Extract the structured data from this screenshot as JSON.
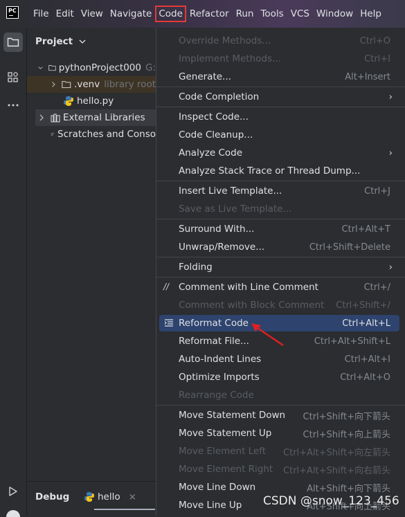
{
  "menubar": {
    "logo_text": "PC",
    "items": [
      {
        "label": "File"
      },
      {
        "label": "Edit"
      },
      {
        "label": "View"
      },
      {
        "label": "Navigate"
      },
      {
        "label": "Code"
      },
      {
        "label": "Refactor"
      },
      {
        "label": "Run"
      },
      {
        "label": "Tools"
      },
      {
        "label": "VCS"
      },
      {
        "label": "Window"
      },
      {
        "label": "Help"
      }
    ]
  },
  "project_panel": {
    "title": "Project",
    "tree": [
      {
        "label": "pythonProject000",
        "suffix": "G:"
      },
      {
        "label": ".venv",
        "suffix": "library root"
      },
      {
        "label": "hello.py"
      },
      {
        "label": "External Libraries"
      },
      {
        "label": "Scratches and Conso"
      }
    ]
  },
  "debug": {
    "label": "Debug",
    "tab": "hello",
    "close": "×"
  },
  "code_menu": {
    "items": [
      {
        "label": "Override Methods...",
        "shortcut": "Ctrl+O",
        "disabled": true
      },
      {
        "label": "Implement Methods...",
        "shortcut": "Ctrl+I",
        "disabled": true
      },
      {
        "label": "Generate...",
        "shortcut": "Alt+Insert"
      },
      {
        "label": "Code Completion",
        "submenu": true
      },
      {
        "label": "Inspect Code..."
      },
      {
        "label": "Code Cleanup..."
      },
      {
        "label": "Analyze Code",
        "submenu": true
      },
      {
        "label": "Analyze Stack Trace or Thread Dump..."
      },
      {
        "label": "Insert Live Template...",
        "shortcut": "Ctrl+J"
      },
      {
        "label": "Save as Live Template...",
        "disabled": true
      },
      {
        "label": "Surround With...",
        "shortcut": "Ctrl+Alt+T"
      },
      {
        "label": "Unwrap/Remove...",
        "shortcut": "Ctrl+Shift+Delete"
      },
      {
        "label": "Folding",
        "submenu": true
      },
      {
        "label": "Comment with Line Comment",
        "shortcut": "Ctrl+/",
        "icon": "comment-icon"
      },
      {
        "label": "Comment with Block Comment",
        "shortcut": "Ctrl+Shift+/",
        "disabled": true
      },
      {
        "label": "Reformat Code",
        "shortcut": "Ctrl+Alt+L",
        "icon": "reformat-icon",
        "highlighted": true
      },
      {
        "label": "Reformat File...",
        "shortcut": "Ctrl+Alt+Shift+L"
      },
      {
        "label": "Auto-Indent Lines",
        "shortcut": "Ctrl+Alt+I"
      },
      {
        "label": "Optimize Imports",
        "shortcut": "Ctrl+Alt+O"
      },
      {
        "label": "Rearrange Code",
        "disabled": true
      },
      {
        "label": "Move Statement Down",
        "shortcut": "Ctrl+Shift+向下箭头"
      },
      {
        "label": "Move Statement Up",
        "shortcut": "Ctrl+Shift+向上箭头"
      },
      {
        "label": "Move Element Left",
        "shortcut": "Ctrl+Alt+Shift+向左箭头",
        "disabled": true
      },
      {
        "label": "Move Element Right",
        "shortcut": "Ctrl+Alt+Shift+向右箭头",
        "disabled": true
      },
      {
        "label": "Move Line Down",
        "shortcut": "Alt+Shift+向下箭头"
      },
      {
        "label": "Move Line Up",
        "shortcut": "Alt+Shift+向上箭头"
      }
    ]
  },
  "arrow_annotation_color": "#e02020",
  "highlight_box_color": "#e53935",
  "watermark": "CSDN @snow_123_456"
}
